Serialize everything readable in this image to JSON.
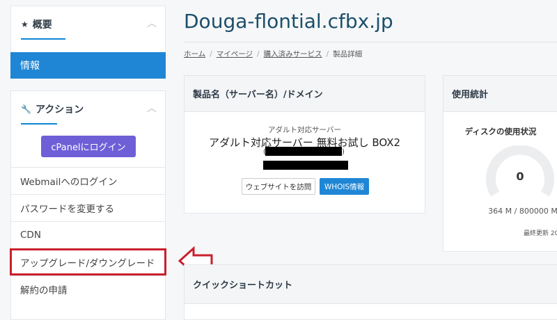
{
  "sidebar": {
    "overview": {
      "title": "概要",
      "active_item": "情報"
    },
    "actions": {
      "title": "アクション",
      "cpanel_button": "cPanelにログイン",
      "items": [
        {
          "label": "Webmailへのログイン"
        },
        {
          "label": "パスワードを変更する"
        },
        {
          "label": "CDN"
        },
        {
          "label": "アップグレード/ダウングレード"
        },
        {
          "label": "解約の申請"
        }
      ]
    }
  },
  "header": {
    "title": "Douga-flontial.cfbx.jp",
    "breadcrumb": [
      "ホーム",
      "マイページ",
      "購入済みサービス",
      "製品詳細"
    ]
  },
  "product_card": {
    "heading": "製品名（サーバー名）/ドメイン",
    "category": "アダルト対応サーバー",
    "product_name": "アダルト対応サーバー 無料お試し BOX2",
    "paren_open": "(",
    "paren_close": ")",
    "visit_button": "ウェブサイトを訪問",
    "whois_button": "WHOIS情報"
  },
  "usage_card": {
    "heading": "使用統計",
    "disk_label": "ディスクの使用状況",
    "gauge_value": "0",
    "usage_text": "364 M / 800000 M",
    "last_updated": "最終更新 20"
  },
  "quick_card": {
    "heading": "クイックショートカット"
  },
  "colors": {
    "accent_blue": "#1f86d5",
    "cpanel_purple": "#6f5fd7",
    "highlight_red": "#c91f2c"
  },
  "icons": {
    "overview": "star-icon",
    "actions": "wrench-icon",
    "collapse": "chevron-up-icon",
    "annotation": "arrow-left-icon"
  }
}
